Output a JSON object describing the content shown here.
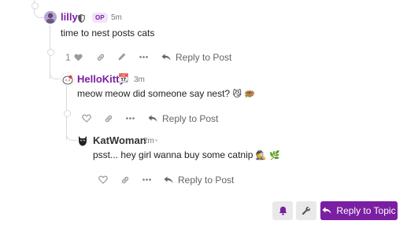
{
  "posts": [
    {
      "username": "lilly",
      "badge": "OP",
      "time": "5m",
      "body": "time to nest posts cats",
      "likes": "1",
      "reply_label": "Reply to Post",
      "name_color": "#7a1fa2"
    },
    {
      "username": "HelloKitty",
      "badge_emoji": "📆",
      "time": "3m",
      "body": "meow meow did someone say nest?",
      "body_emoji": "😼 🪹",
      "reply_label": "Reply to Post",
      "name_color": "#7a1fa2"
    },
    {
      "username": "KatWoman",
      "time": "2m",
      "body": "psst... hey girl wanna buy some catnip",
      "body_emoji": "🕵 🌿",
      "reply_label": "Reply to Post",
      "name_color": "#333333"
    }
  ],
  "footer": {
    "notify_icon": "bell-icon",
    "admin_icon": "wrench-icon",
    "reply_topic_label": "Reply to Topic",
    "accent": "#7a1fa2"
  }
}
